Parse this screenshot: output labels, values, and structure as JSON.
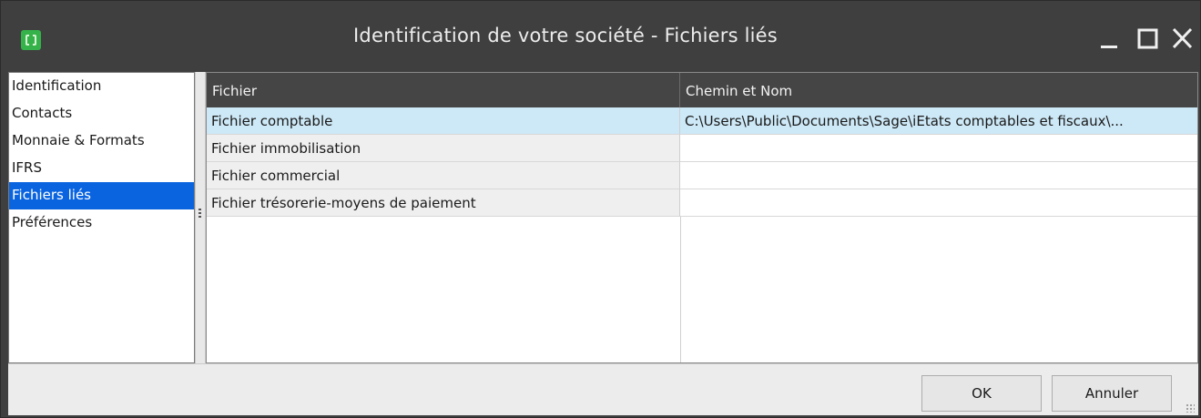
{
  "window": {
    "title": "Identification de votre société - Fichiers liés"
  },
  "sidebar": {
    "items": [
      {
        "label": "Identification"
      },
      {
        "label": "Contacts"
      },
      {
        "label": "Monnaie & Formats"
      },
      {
        "label": "IFRS"
      },
      {
        "label": "Fichiers liés",
        "active": true
      },
      {
        "label": "Préférences"
      }
    ]
  },
  "grid": {
    "columns": [
      "Fichier",
      "Chemin et Nom"
    ],
    "rows": [
      {
        "fichier": "Fichier comptable",
        "chemin": "C:\\Users\\Public\\Documents\\Sage\\iEtats comptables et fiscaux\\...",
        "selected": true
      },
      {
        "fichier": "Fichier immobilisation",
        "chemin": ""
      },
      {
        "fichier": "Fichier commercial",
        "chemin": ""
      },
      {
        "fichier": "Fichier trésorerie-moyens de paiement",
        "chemin": ""
      }
    ]
  },
  "footer": {
    "ok_label": "OK",
    "cancel_label": "Annuler"
  },
  "colors": {
    "titlebar": "#3f3f3f",
    "selection": "#0a64e0",
    "row_highlight": "#cde8f6",
    "header": "#454545"
  },
  "icons": {
    "app": "app-icon",
    "minimize": "minimize-icon",
    "maximize": "maximize-icon",
    "close": "close-icon"
  }
}
